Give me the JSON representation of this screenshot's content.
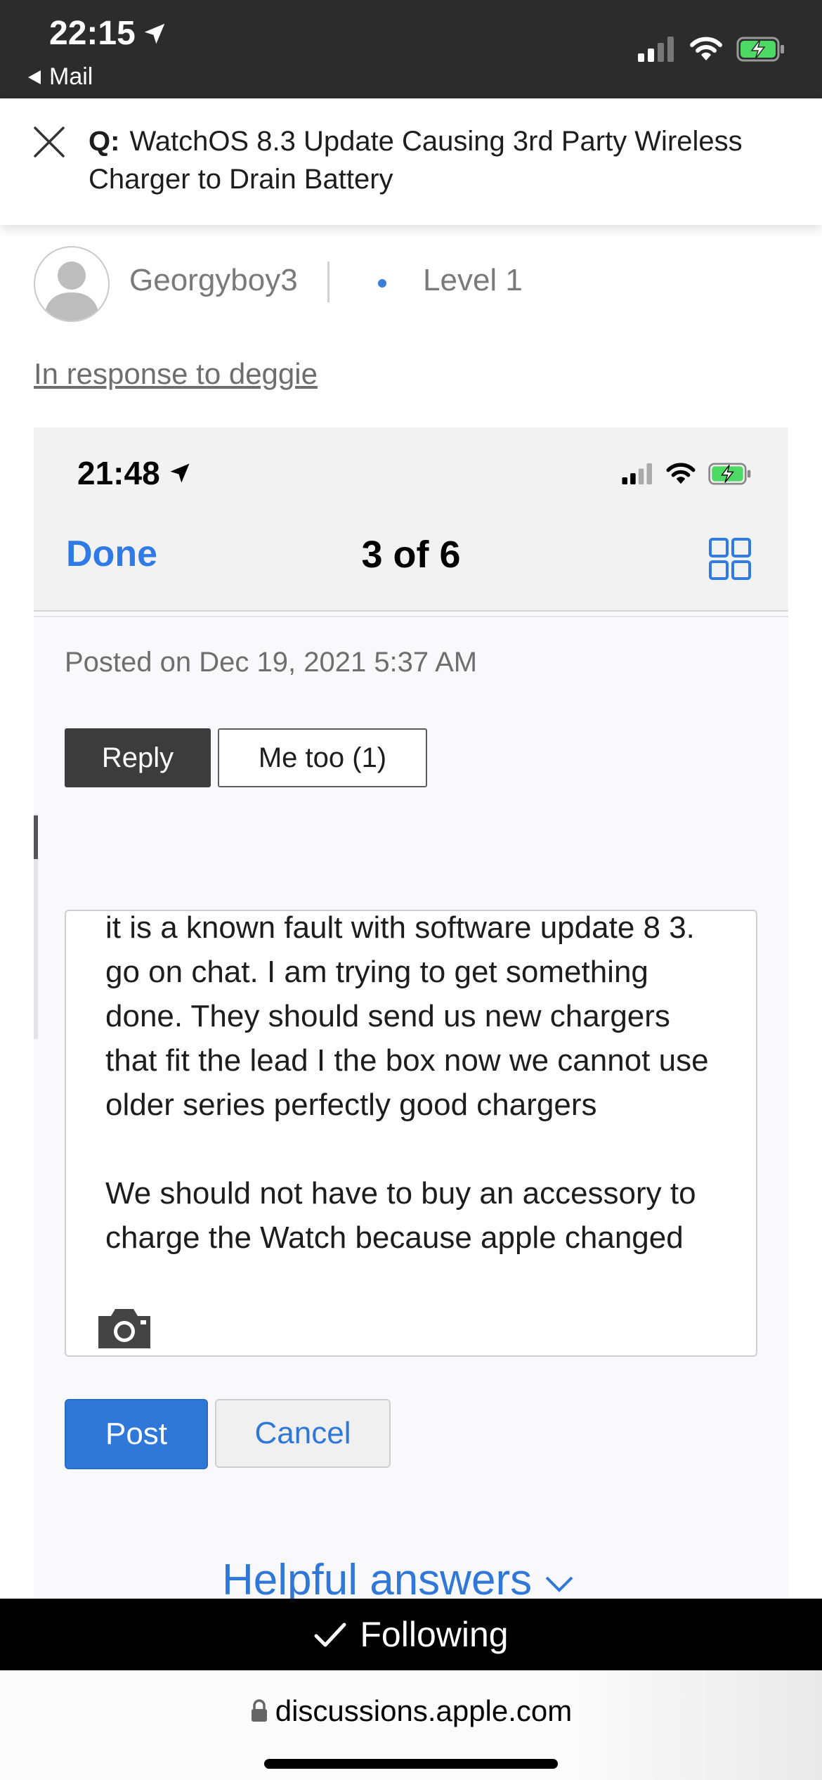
{
  "status_bar": {
    "time": "22:15",
    "back_label": "Mail"
  },
  "question": {
    "prefix": "Q:",
    "title": "WatchOS 8.3 Update Causing 3rd Party Wireless Charger to Drain Battery"
  },
  "post": {
    "author": "Georgyboy3",
    "level": "Level 1",
    "in_response": "In response to deggie"
  },
  "embedded_screenshot": {
    "time": "21:48",
    "done_label": "Done",
    "counter": "3 of 6",
    "posted_on": "Posted on Dec 19, 2021 5:37 AM",
    "reply_label": "Reply",
    "me_too_label": "Me too (1)",
    "reply_text": "it is a known fault with software update 8 3.\ngo on chat. I am trying to get something done. They should send us new chargers that fit the lead I the box now we cannot use older series perfectly good chargers\n\nWe should not have to buy an accessory to charge the Watch because apple changed",
    "post_label": "Post",
    "cancel_label": "Cancel",
    "helpful_label": "Helpful answers"
  },
  "following_label": "Following",
  "url": "discussions.apple.com",
  "colors": {
    "accent": "#2f78d8",
    "status_bar": "#2c2c2c",
    "battery_green": "#4cd964"
  }
}
